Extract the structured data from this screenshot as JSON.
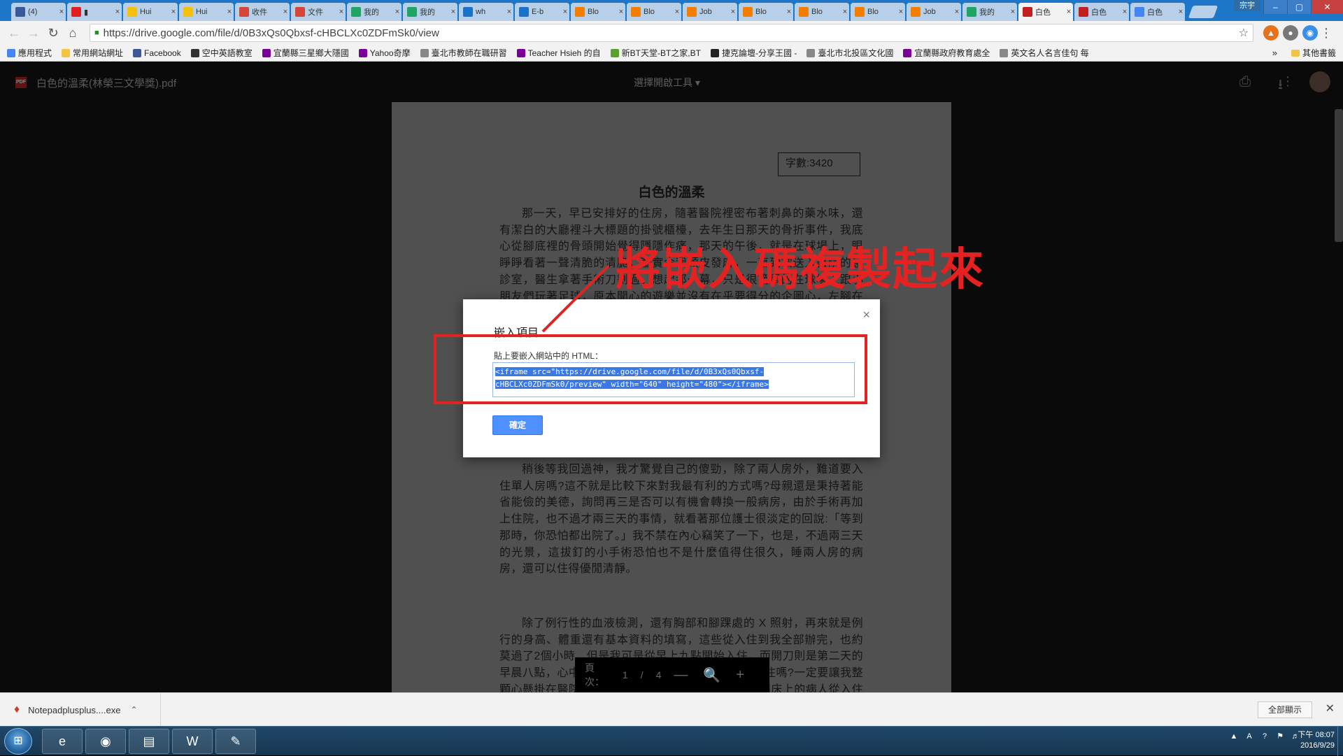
{
  "tabs": [
    {
      "label": "(4)",
      "color": "#3b5998",
      "icon": "facebook-icon"
    },
    {
      "label": "▮",
      "color": "#e02020",
      "icon": "youtube-icon"
    },
    {
      "label": "Hui",
      "color": "#f4c20d",
      "icon": "yahoo-icon"
    },
    {
      "label": "Hui",
      "color": "#f4c20d",
      "icon": "yahoo-icon"
    },
    {
      "label": "收件",
      "color": "#d44638",
      "icon": "gmail-icon"
    },
    {
      "label": "文件",
      "color": "#d44638",
      "icon": "gmail-icon"
    },
    {
      "label": "我的",
      "color": "#1fa463",
      "icon": "drive-icon"
    },
    {
      "label": "我的",
      "color": "#1fa463",
      "icon": "drive-icon"
    },
    {
      "label": "wh",
      "color": "#1a73c8",
      "icon": "doc-icon"
    },
    {
      "label": "E-b",
      "color": "#1a73c8",
      "icon": "doc-icon"
    },
    {
      "label": "Blo",
      "color": "#f57d00",
      "icon": "blogger-icon"
    },
    {
      "label": "Blo",
      "color": "#f57d00",
      "icon": "blogger-icon"
    },
    {
      "label": "Job",
      "color": "#f57d00",
      "icon": "blogger-icon"
    },
    {
      "label": "Blo",
      "color": "#f57d00",
      "icon": "blogger-icon"
    },
    {
      "label": "Blo",
      "color": "#f57d00",
      "icon": "blogger-icon"
    },
    {
      "label": "Blo",
      "color": "#f57d00",
      "icon": "blogger-icon"
    },
    {
      "label": "Job",
      "color": "#f57d00",
      "icon": "blogger-icon"
    },
    {
      "label": "我的",
      "color": "#1fa463",
      "icon": "drive-icon"
    },
    {
      "label": "白色",
      "color": "#c21f1f",
      "icon": "pdf-icon",
      "active": true
    },
    {
      "label": "白色",
      "color": "#c21f1f",
      "icon": "pdf-icon"
    },
    {
      "label": "白色",
      "color": "#4285f4",
      "icon": "doc-icon"
    }
  ],
  "window": {
    "user": "宗宇",
    "minimize": "–",
    "maximize": "▢",
    "close": "✕"
  },
  "toolbar": {
    "url": "https://drive.google.com/file/d/0B3xQs0Qbxsf-cHBCLXc0ZDFmSk0/view",
    "back": "←",
    "forward": "→",
    "reload": "↻",
    "home": "⌂",
    "star": "☆"
  },
  "bookmarks": [
    {
      "label": "應用程式",
      "icon": "apps-grid-icon"
    },
    {
      "label": "常用網站網址",
      "icon": "folder-icon"
    },
    {
      "label": "Facebook",
      "icon": "facebook-icon"
    },
    {
      "label": "空中英語教室",
      "icon": "clock-icon"
    },
    {
      "label": "宜蘭縣三星鄉大隱國",
      "icon": "yahoo-icon"
    },
    {
      "label": "Yahoo奇摩",
      "icon": "yahoo-icon"
    },
    {
      "label": "臺北市教師在職研習",
      "icon": "page-icon"
    },
    {
      "label": "Teacher Hsieh 的自",
      "icon": "yahoo-icon"
    },
    {
      "label": "新BT天堂-BT之家,BT",
      "icon": "leaf-icon"
    },
    {
      "label": "捷克論壇-分享王國 -",
      "icon": "jk-icon"
    },
    {
      "label": "臺北市北投區文化國",
      "icon": "page-icon"
    },
    {
      "label": "宜蘭縣政府教育處全",
      "icon": "yahoo-icon"
    },
    {
      "label": "英文名人名言佳句 每",
      "icon": "page-icon"
    }
  ],
  "bookmarks_more": "»",
  "bookmarks_other": "其他書籤",
  "viewer": {
    "filename": "白色的溫柔(林榮三文學獎).pdf",
    "open_with": "選擇開啟工具 ▾",
    "print": "⎙",
    "download": "⭳",
    "more": "⋮"
  },
  "doc": {
    "word_count": "字數:3420",
    "title": "白色的溫柔",
    "para1": "那一天，早已安排好的住房，隨著醫院裡密布著刺鼻的藥水味，還有潔白的大廳裡斗大標題的掛號櫃檯，去年生日那天的骨折事件，我底心從腳底裡的骨頭開始覺得隱隱作痛，那天的午後，就是在球場上，眼睜睜看著一聲清脆的清脆，著實令我頭皮發麻，一直到被送入醫院的急診室，醫生拿著手術刀劃過。想起那一幕，只是很簡單的在球場上跟小朋友們玩著足球，原本開心的遊樂並沒有在乎要得分的企圖心，左腳在球上盤旋，左腳一個迴旋的動作",
    "para2": "稍後等我回過神，我才驚覺自己的傻勁，除了兩人房外，難道要入住單人房嗎?這不就是比較下來對我最有利的方式嗎?母親還是秉持著能省能儉的美德，詢問再三是否可以有機會轉換一般病房，由於手術再加上住院，也不過才兩三天的事情，就看著那位護士很淡定的回說:「等到那時，你恐怕都出院了。」我不禁在內心竊笑了一下，也是，不過兩三天的光景，這拔釘的小手術恐怕也不是什麼值得住很久，睡兩人房的病房，還可以住得優閒清靜。",
    "para3": "除了例行性的血液檢測，還有胸部和腳踝處的 X 照射，再來就是例行的身高、體重還有基本資料的填寫，這些從入住到我全部辦完，也約莫過了2個小時，但是我可是從早上九點開始入住，而開刀則是第二天的早晨八點，心中總是不斷地納悶，難道我不能晚上入住嗎?一定要讓我整顆心懸掛在醫院的天花板上，跟著一臉蒼白嗎?左邊病床上的病人從入住那天開始就始終只見陪伴的家人，從他們的對話中，從他們的對話出可以依稀聽出是以身相的地方的開刀，雖然聽了半晌，也還是不清楚害了什麼"
  },
  "pagebar": {
    "label": "頁次：",
    "current": "1",
    "sep": "/",
    "total": "4",
    "zoom_out": "—",
    "zoom_fit": "🔍",
    "zoom_in": "+"
  },
  "modal": {
    "title": "嵌入項目",
    "close": "×",
    "label": "貼上要嵌入網站中的 HTML：",
    "code": "<iframe src=\"https://drive.google.com/file/d/0B3xQs0Qbxsf-cHBCLXc0ZDFmSk0/preview\" width=\"640\" height=\"480\"></iframe>",
    "ok": "確定"
  },
  "annotation": {
    "text": "將嵌入碼複製起來",
    "color": "#e52222"
  },
  "download": {
    "filename": "Notepadplusplus....exe",
    "chevron": "⌃",
    "show_all": "全部顯示",
    "close": "✕"
  },
  "taskbar": {
    "start": "⊞",
    "apps": [
      {
        "icon": "ie-icon",
        "glyph": "e"
      },
      {
        "icon": "chrome-icon",
        "glyph": "◉"
      },
      {
        "icon": "explorer-icon",
        "glyph": "▤"
      },
      {
        "icon": "word-icon",
        "glyph": "W"
      },
      {
        "icon": "paint-icon",
        "glyph": "✎"
      }
    ],
    "time": "下午 08:07",
    "date": "2016/9/29"
  }
}
